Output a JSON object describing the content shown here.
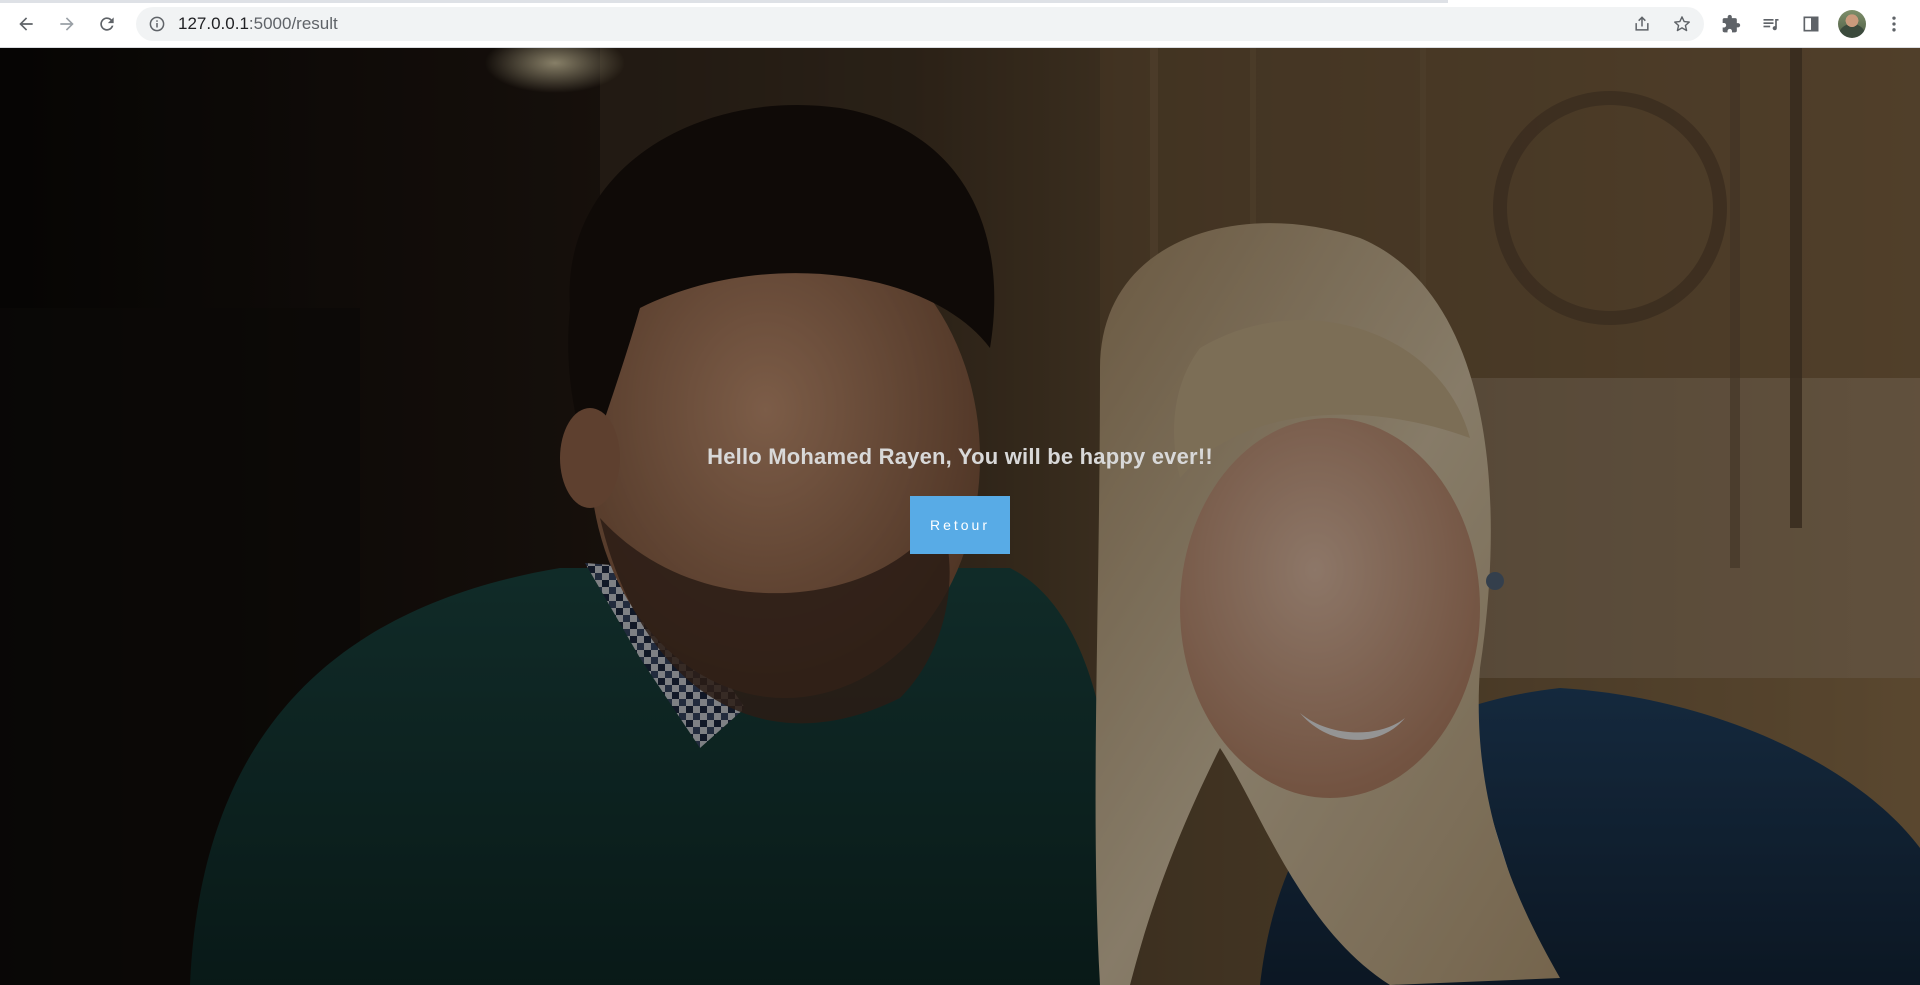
{
  "browser": {
    "url_host": "127.0.0.1",
    "url_path": ":5000/result",
    "icons": {
      "back": "arrow-left-icon",
      "forward": "arrow-right-icon",
      "reload": "reload-icon",
      "site_info": "info-icon",
      "share": "share-icon",
      "bookmark": "star-icon",
      "extensions": "puzzle-icon",
      "media": "media-control-icon",
      "side_panel": "side-panel-icon",
      "menu": "kebab-menu-icon"
    }
  },
  "page": {
    "message": "Hello Mohamed Rayen, You will be happy ever!!",
    "button_label": "Retour",
    "colors": {
      "button": "#58abe6",
      "message": "#d8d8d8"
    }
  }
}
